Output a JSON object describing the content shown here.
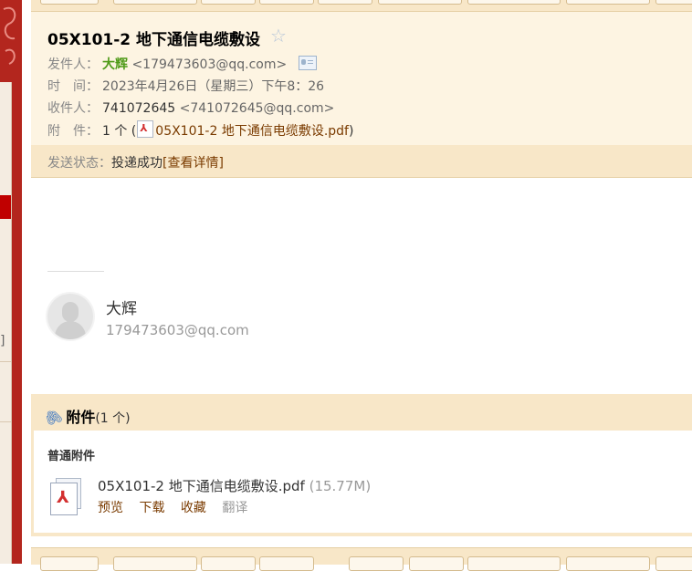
{
  "email": {
    "subject": "05X101-2 地下通信电缆敷设",
    "star_glyph": "☆",
    "sender_label": "发件人：",
    "sender_name": "大辉",
    "sender_addr": "<179473603@qq.com>",
    "time_label": "时　间：",
    "time_value": "2023年4月26日（星期三）下午8：26",
    "to_label": "收件人：",
    "to_name": "741072645",
    "to_addr": "<741072645@qq.com>",
    "attach_label": "附　件：",
    "attach_count_prefix": "1 个 (",
    "attach_link": "05X101-2 地下通信电缆敷设.pdf",
    "attach_count_suffix": ")"
  },
  "status": {
    "label": "发送状态：",
    "value": "投递成功",
    "detail": "[查看详情]"
  },
  "signature": {
    "name": "大辉",
    "email": "179473603@qq.com"
  },
  "attachments": {
    "title": "附件",
    "count": "(1 个)",
    "group_label": "普通附件",
    "file_name": "05X101-2 地下通信电缆敷设.pdf",
    "file_size": "(15.77M)",
    "actions": [
      "预览",
      "下载",
      "收藏",
      "翻译"
    ]
  },
  "left_panel": {
    "bracket": "]"
  },
  "colors": {
    "header_bg": "#fdf4e2",
    "bar_bg": "#f8e7c8",
    "sender_green": "#4f9a18",
    "link_brown": "#7a3b00",
    "left_red": "#b3261e"
  },
  "icons": [
    "star-icon",
    "contact-card-icon",
    "pdf-icon",
    "paperclip-icon",
    "avatar-icon"
  ]
}
